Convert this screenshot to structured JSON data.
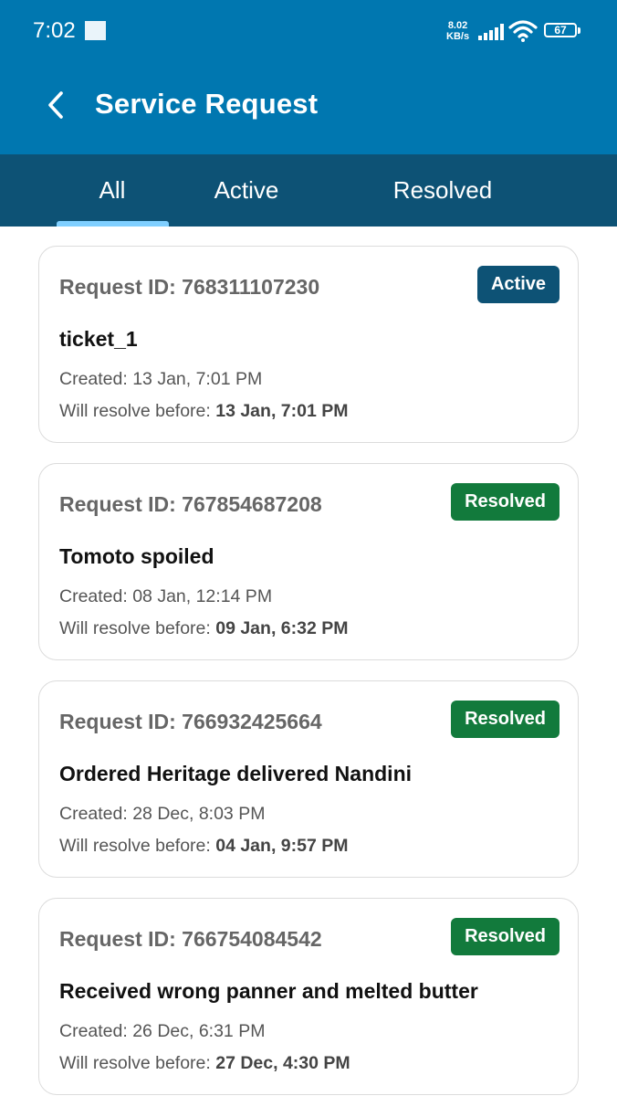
{
  "status_bar": {
    "time": "7:02",
    "net_speed_value": "8.02",
    "net_speed_unit": "KB/s",
    "battery": "67"
  },
  "header": {
    "title": "Service Request",
    "back_icon": "chevron-left-icon"
  },
  "tabs": [
    {
      "label": "All",
      "selected": true
    },
    {
      "label": "Active",
      "selected": false
    },
    {
      "label": "Resolved",
      "selected": false
    }
  ],
  "colors": {
    "appbar": "#0077b0",
    "tabbar": "#0d5275",
    "tab_indicator": "#7fcfff",
    "badge_active": "#0d5275",
    "badge_resolved": "#127a3c"
  },
  "requests": [
    {
      "request_id": "Request ID: 768311107230",
      "status": "Active",
      "title": "ticket_1",
      "created": "Created: 13 Jan, 7:01 PM",
      "resolve_label": "Will resolve before: ",
      "resolve_value": "13 Jan, 7:01 PM"
    },
    {
      "request_id": "Request ID: 767854687208",
      "status": "Resolved",
      "title": "Tomoto spoiled",
      "created": "Created: 08 Jan, 12:14 PM",
      "resolve_label": "Will resolve before: ",
      "resolve_value": "09 Jan, 6:32 PM"
    },
    {
      "request_id": "Request ID: 766932425664",
      "status": "Resolved",
      "title": "Ordered Heritage delivered Nandini",
      "created": "Created: 28 Dec, 8:03 PM",
      "resolve_label": "Will resolve before: ",
      "resolve_value": "04 Jan, 9:57 PM"
    },
    {
      "request_id": "Request ID: 766754084542",
      "status": "Resolved",
      "title": "Received wrong panner and melted butter",
      "created": "Created: 26 Dec, 6:31 PM",
      "resolve_label": "Will resolve before: ",
      "resolve_value": "27 Dec, 4:30 PM"
    }
  ]
}
